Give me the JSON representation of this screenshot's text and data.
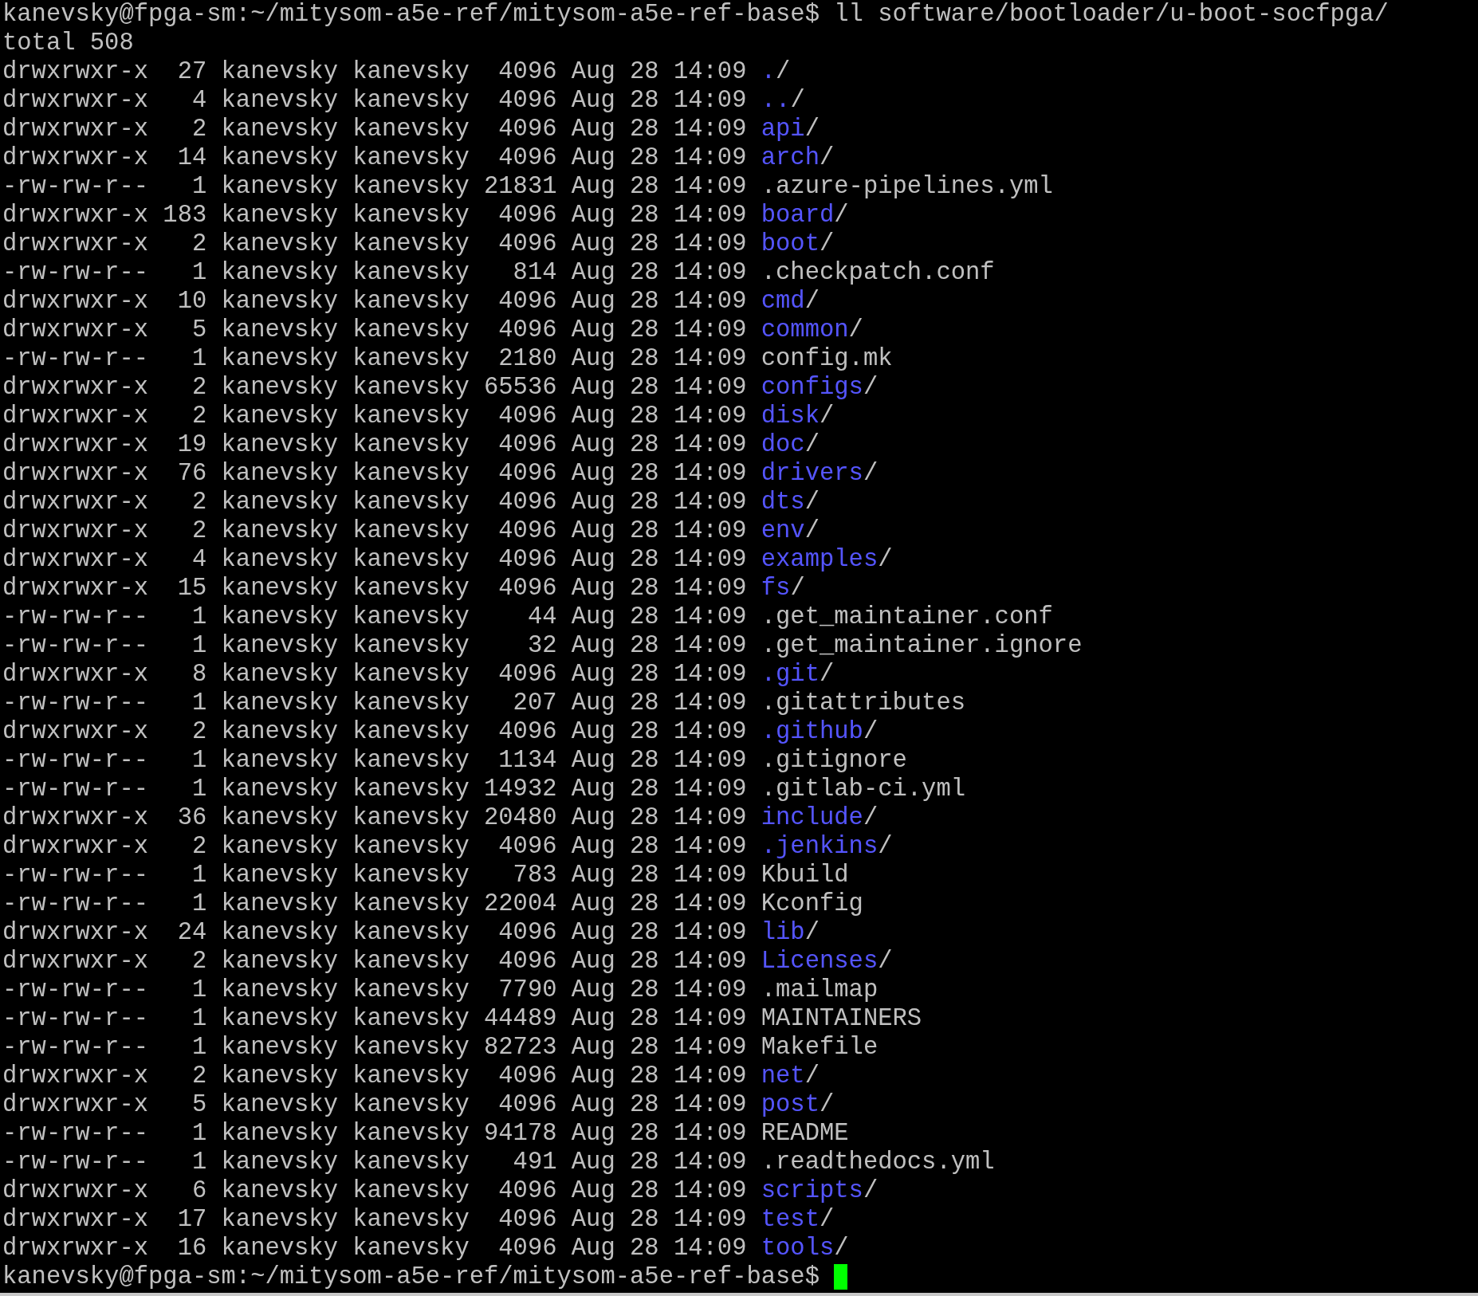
{
  "terminal": {
    "command_line": {
      "prompt": "kanevsky@fpga-sm:~/mitysom-a5e-ref/mitysom-a5e-ref-base$",
      "command": "ll software/bootloader/u-boot-socfpga/"
    },
    "total": "total 508",
    "entries": [
      {
        "perms": "drwxrwxr-x",
        "links": "27",
        "owner": "kanevsky",
        "group": "kanevsky",
        "size": "4096",
        "date": "Aug 28 14:09",
        "name": ".",
        "suffix": "/",
        "kind": "dir"
      },
      {
        "perms": "drwxrwxr-x",
        "links": "4",
        "owner": "kanevsky",
        "group": "kanevsky",
        "size": "4096",
        "date": "Aug 28 14:09",
        "name": "..",
        "suffix": "/",
        "kind": "dir"
      },
      {
        "perms": "drwxrwxr-x",
        "links": "2",
        "owner": "kanevsky",
        "group": "kanevsky",
        "size": "4096",
        "date": "Aug 28 14:09",
        "name": "api",
        "suffix": "/",
        "kind": "dir"
      },
      {
        "perms": "drwxrwxr-x",
        "links": "14",
        "owner": "kanevsky",
        "group": "kanevsky",
        "size": "4096",
        "date": "Aug 28 14:09",
        "name": "arch",
        "suffix": "/",
        "kind": "dir"
      },
      {
        "perms": "-rw-rw-r--",
        "links": "1",
        "owner": "kanevsky",
        "group": "kanevsky",
        "size": "21831",
        "date": "Aug 28 14:09",
        "name": ".azure-pipelines.yml",
        "kind": "file"
      },
      {
        "perms": "drwxrwxr-x",
        "links": "183",
        "owner": "kanevsky",
        "group": "kanevsky",
        "size": "4096",
        "date": "Aug 28 14:09",
        "name": "board",
        "suffix": "/",
        "kind": "dir"
      },
      {
        "perms": "drwxrwxr-x",
        "links": "2",
        "owner": "kanevsky",
        "group": "kanevsky",
        "size": "4096",
        "date": "Aug 28 14:09",
        "name": "boot",
        "suffix": "/",
        "kind": "dir"
      },
      {
        "perms": "-rw-rw-r--",
        "links": "1",
        "owner": "kanevsky",
        "group": "kanevsky",
        "size": "814",
        "date": "Aug 28 14:09",
        "name": ".checkpatch.conf",
        "kind": "file"
      },
      {
        "perms": "drwxrwxr-x",
        "links": "10",
        "owner": "kanevsky",
        "group": "kanevsky",
        "size": "4096",
        "date": "Aug 28 14:09",
        "name": "cmd",
        "suffix": "/",
        "kind": "dir"
      },
      {
        "perms": "drwxrwxr-x",
        "links": "5",
        "owner": "kanevsky",
        "group": "kanevsky",
        "size": "4096",
        "date": "Aug 28 14:09",
        "name": "common",
        "suffix": "/",
        "kind": "dir"
      },
      {
        "perms": "-rw-rw-r--",
        "links": "1",
        "owner": "kanevsky",
        "group": "kanevsky",
        "size": "2180",
        "date": "Aug 28 14:09",
        "name": "config.mk",
        "kind": "file"
      },
      {
        "perms": "drwxrwxr-x",
        "links": "2",
        "owner": "kanevsky",
        "group": "kanevsky",
        "size": "65536",
        "date": "Aug 28 14:09",
        "name": "configs",
        "suffix": "/",
        "kind": "dir"
      },
      {
        "perms": "drwxrwxr-x",
        "links": "2",
        "owner": "kanevsky",
        "group": "kanevsky",
        "size": "4096",
        "date": "Aug 28 14:09",
        "name": "disk",
        "suffix": "/",
        "kind": "dir"
      },
      {
        "perms": "drwxrwxr-x",
        "links": "19",
        "owner": "kanevsky",
        "group": "kanevsky",
        "size": "4096",
        "date": "Aug 28 14:09",
        "name": "doc",
        "suffix": "/",
        "kind": "dir"
      },
      {
        "perms": "drwxrwxr-x",
        "links": "76",
        "owner": "kanevsky",
        "group": "kanevsky",
        "size": "4096",
        "date": "Aug 28 14:09",
        "name": "drivers",
        "suffix": "/",
        "kind": "dir"
      },
      {
        "perms": "drwxrwxr-x",
        "links": "2",
        "owner": "kanevsky",
        "group": "kanevsky",
        "size": "4096",
        "date": "Aug 28 14:09",
        "name": "dts",
        "suffix": "/",
        "kind": "dir"
      },
      {
        "perms": "drwxrwxr-x",
        "links": "2",
        "owner": "kanevsky",
        "group": "kanevsky",
        "size": "4096",
        "date": "Aug 28 14:09",
        "name": "env",
        "suffix": "/",
        "kind": "dir"
      },
      {
        "perms": "drwxrwxr-x",
        "links": "4",
        "owner": "kanevsky",
        "group": "kanevsky",
        "size": "4096",
        "date": "Aug 28 14:09",
        "name": "examples",
        "suffix": "/",
        "kind": "dir"
      },
      {
        "perms": "drwxrwxr-x",
        "links": "15",
        "owner": "kanevsky",
        "group": "kanevsky",
        "size": "4096",
        "date": "Aug 28 14:09",
        "name": "fs",
        "suffix": "/",
        "kind": "dir"
      },
      {
        "perms": "-rw-rw-r--",
        "links": "1",
        "owner": "kanevsky",
        "group": "kanevsky",
        "size": "44",
        "date": "Aug 28 14:09",
        "name": ".get_maintainer.conf",
        "kind": "file"
      },
      {
        "perms": "-rw-rw-r--",
        "links": "1",
        "owner": "kanevsky",
        "group": "kanevsky",
        "size": "32",
        "date": "Aug 28 14:09",
        "name": ".get_maintainer.ignore",
        "kind": "file"
      },
      {
        "perms": "drwxrwxr-x",
        "links": "8",
        "owner": "kanevsky",
        "group": "kanevsky",
        "size": "4096",
        "date": "Aug 28 14:09",
        "name": ".git",
        "suffix": "/",
        "kind": "dir"
      },
      {
        "perms": "-rw-rw-r--",
        "links": "1",
        "owner": "kanevsky",
        "group": "kanevsky",
        "size": "207",
        "date": "Aug 28 14:09",
        "name": ".gitattributes",
        "kind": "file"
      },
      {
        "perms": "drwxrwxr-x",
        "links": "2",
        "owner": "kanevsky",
        "group": "kanevsky",
        "size": "4096",
        "date": "Aug 28 14:09",
        "name": ".github",
        "suffix": "/",
        "kind": "dir"
      },
      {
        "perms": "-rw-rw-r--",
        "links": "1",
        "owner": "kanevsky",
        "group": "kanevsky",
        "size": "1134",
        "date": "Aug 28 14:09",
        "name": ".gitignore",
        "kind": "file"
      },
      {
        "perms": "-rw-rw-r--",
        "links": "1",
        "owner": "kanevsky",
        "group": "kanevsky",
        "size": "14932",
        "date": "Aug 28 14:09",
        "name": ".gitlab-ci.yml",
        "kind": "file"
      },
      {
        "perms": "drwxrwxr-x",
        "links": "36",
        "owner": "kanevsky",
        "group": "kanevsky",
        "size": "20480",
        "date": "Aug 28 14:09",
        "name": "include",
        "suffix": "/",
        "kind": "dir"
      },
      {
        "perms": "drwxrwxr-x",
        "links": "2",
        "owner": "kanevsky",
        "group": "kanevsky",
        "size": "4096",
        "date": "Aug 28 14:09",
        "name": ".jenkins",
        "suffix": "/",
        "kind": "dir"
      },
      {
        "perms": "-rw-rw-r--",
        "links": "1",
        "owner": "kanevsky",
        "group": "kanevsky",
        "size": "783",
        "date": "Aug 28 14:09",
        "name": "Kbuild",
        "kind": "file"
      },
      {
        "perms": "-rw-rw-r--",
        "links": "1",
        "owner": "kanevsky",
        "group": "kanevsky",
        "size": "22004",
        "date": "Aug 28 14:09",
        "name": "Kconfig",
        "kind": "file"
      },
      {
        "perms": "drwxrwxr-x",
        "links": "24",
        "owner": "kanevsky",
        "group": "kanevsky",
        "size": "4096",
        "date": "Aug 28 14:09",
        "name": "lib",
        "suffix": "/",
        "kind": "dir"
      },
      {
        "perms": "drwxrwxr-x",
        "links": "2",
        "owner": "kanevsky",
        "group": "kanevsky",
        "size": "4096",
        "date": "Aug 28 14:09",
        "name": "Licenses",
        "suffix": "/",
        "kind": "dir"
      },
      {
        "perms": "-rw-rw-r--",
        "links": "1",
        "owner": "kanevsky",
        "group": "kanevsky",
        "size": "7790",
        "date": "Aug 28 14:09",
        "name": ".mailmap",
        "kind": "file"
      },
      {
        "perms": "-rw-rw-r--",
        "links": "1",
        "owner": "kanevsky",
        "group": "kanevsky",
        "size": "44489",
        "date": "Aug 28 14:09",
        "name": "MAINTAINERS",
        "kind": "file"
      },
      {
        "perms": "-rw-rw-r--",
        "links": "1",
        "owner": "kanevsky",
        "group": "kanevsky",
        "size": "82723",
        "date": "Aug 28 14:09",
        "name": "Makefile",
        "kind": "file"
      },
      {
        "perms": "drwxrwxr-x",
        "links": "2",
        "owner": "kanevsky",
        "group": "kanevsky",
        "size": "4096",
        "date": "Aug 28 14:09",
        "name": "net",
        "suffix": "/",
        "kind": "dir"
      },
      {
        "perms": "drwxrwxr-x",
        "links": "5",
        "owner": "kanevsky",
        "group": "kanevsky",
        "size": "4096",
        "date": "Aug 28 14:09",
        "name": "post",
        "suffix": "/",
        "kind": "dir"
      },
      {
        "perms": "-rw-rw-r--",
        "links": "1",
        "owner": "kanevsky",
        "group": "kanevsky",
        "size": "94178",
        "date": "Aug 28 14:09",
        "name": "README",
        "kind": "file"
      },
      {
        "perms": "-rw-rw-r--",
        "links": "1",
        "owner": "kanevsky",
        "group": "kanevsky",
        "size": "491",
        "date": "Aug 28 14:09",
        "name": ".readthedocs.yml",
        "kind": "file"
      },
      {
        "perms": "drwxrwxr-x",
        "links": "6",
        "owner": "kanevsky",
        "group": "kanevsky",
        "size": "4096",
        "date": "Aug 28 14:09",
        "name": "scripts",
        "suffix": "/",
        "kind": "dir"
      },
      {
        "perms": "drwxrwxr-x",
        "links": "17",
        "owner": "kanevsky",
        "group": "kanevsky",
        "size": "4096",
        "date": "Aug 28 14:09",
        "name": "test",
        "suffix": "/",
        "kind": "dir"
      },
      {
        "perms": "drwxrwxr-x",
        "links": "16",
        "owner": "kanevsky",
        "group": "kanevsky",
        "size": "4096",
        "date": "Aug 28 14:09",
        "name": "tools",
        "suffix": "/",
        "kind": "dir"
      }
    ],
    "final_prompt": "kanevsky@fpga-sm:~/mitysom-a5e-ref/mitysom-a5e-ref-base$"
  }
}
